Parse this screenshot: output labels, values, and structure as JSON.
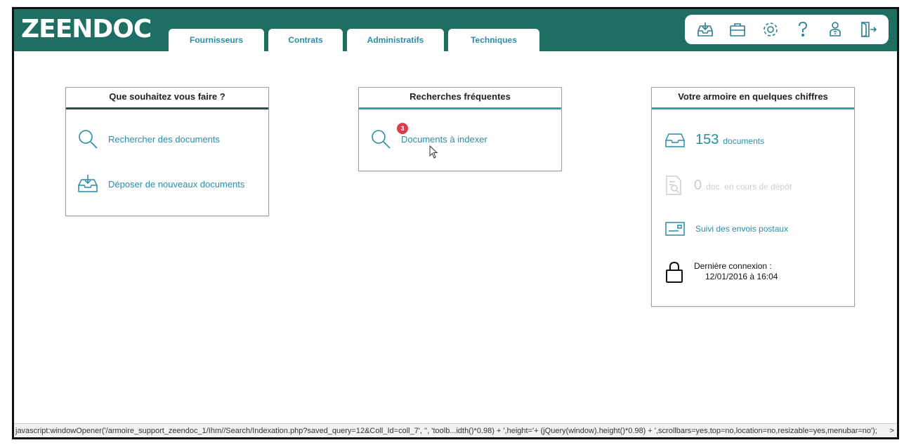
{
  "app": {
    "logo": "ZEENDOC"
  },
  "tabs": [
    {
      "label": "Fournisseurs"
    },
    {
      "label": "Contrats"
    },
    {
      "label": "Administratifs"
    },
    {
      "label": "Techniques"
    }
  ],
  "toolbar": {
    "icons": [
      "inbox-download-icon",
      "briefcase-icon",
      "gear-icon",
      "help-icon",
      "user-badge-icon",
      "logout-icon"
    ]
  },
  "panel_actions": {
    "title": "Que souhaitez vous faire ?",
    "items": [
      {
        "label": "Rechercher des documents",
        "icon": "search-icon"
      },
      {
        "label": "Déposer de nouveaux documents",
        "icon": "inbox-download-icon"
      }
    ]
  },
  "panel_frequent": {
    "title": "Recherches fréquentes",
    "items": [
      {
        "label": "Documents à indexer",
        "icon": "search-icon",
        "badge": "3"
      }
    ]
  },
  "panel_stats": {
    "title": "Votre armoire en quelques chiffres",
    "documents_count": "153",
    "documents_label": "documents",
    "pending_count": "0",
    "pending_label": "doc. en cours de dépôt",
    "postal_label": "Suivi des envois postaux",
    "last_login_label": "Dernière connexion :",
    "last_login_value": "12/01/2016 à 16:04"
  },
  "statusbar": {
    "text": "javascript:windowOpener('/armoire_support_zeendoc_1/Ihm//Search/Indexation.php?saved_query=12&Coll_Id=coll_7', '', 'toolb...idth()*0.98) + ',height='+ (jQuery(window).height()*0.98) + ',scrollbars=yes,top=no,location=no,resizable=yes,menubar=no');",
    "arrow": ">"
  },
  "colors": {
    "brand": "#1e6f62",
    "link": "#2a8ca6",
    "badge": "#e03a4a"
  }
}
